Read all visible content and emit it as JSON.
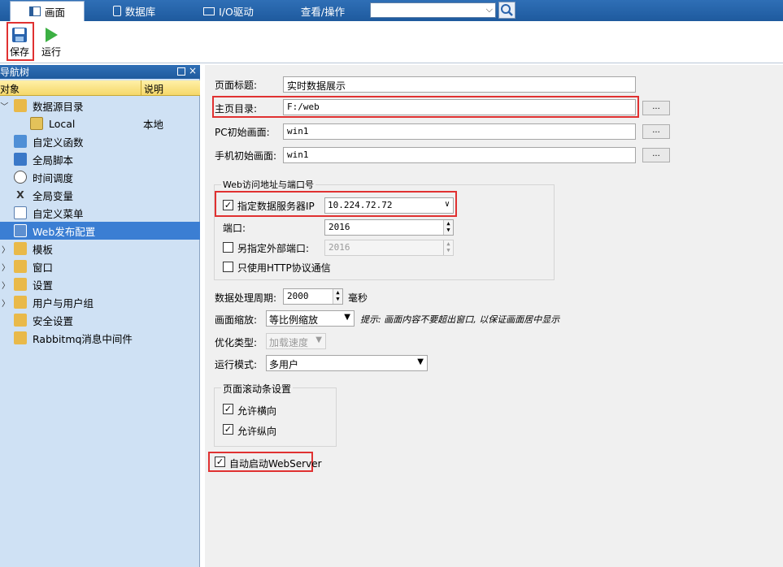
{
  "top_tabs": [
    {
      "label": "画面",
      "icon": "screen-icon"
    },
    {
      "label": "数据库",
      "icon": "database-icon"
    },
    {
      "label": "I/O驱动",
      "icon": "io-driver-icon"
    },
    {
      "label": "查看/操作",
      "icon": ""
    }
  ],
  "search": {
    "value": ""
  },
  "toolbar": {
    "save_label": "保存",
    "run_label": "运行"
  },
  "sidebar": {
    "title": "导航树",
    "col_object": "对象",
    "col_desc": "说明",
    "items": [
      {
        "label": "数据源目录",
        "desc": "",
        "expanded": true
      },
      {
        "label": "Local",
        "desc": "本地"
      },
      {
        "label": "自定义函数",
        "desc": ""
      },
      {
        "label": "全局脚本",
        "desc": ""
      },
      {
        "label": "时间调度",
        "desc": ""
      },
      {
        "label": "全局变量",
        "desc": ""
      },
      {
        "label": "自定义菜单",
        "desc": ""
      },
      {
        "label": "Web发布配置",
        "desc": "",
        "selected": true
      },
      {
        "label": "模板",
        "desc": ""
      },
      {
        "label": "窗口",
        "desc": ""
      },
      {
        "label": "设置",
        "desc": ""
      },
      {
        "label": "用户与用户组",
        "desc": ""
      },
      {
        "label": "安全设置",
        "desc": ""
      },
      {
        "label": "Rabbitmq消息中间件",
        "desc": ""
      }
    ]
  },
  "form": {
    "page_title_label": "页面标题:",
    "page_title_value": "实时数据展示",
    "home_dir_label": "主页目录:",
    "home_dir_value": "F:/web",
    "pc_init_label": "PC初始画面:",
    "pc_init_value": "win1",
    "mobile_init_label": "手机初始画面:",
    "mobile_init_value": "win1",
    "browse_label": "...",
    "web_group_title": "Web访问地址与端口号",
    "server_ip_label": "指定数据服务器IP",
    "server_ip_checked": true,
    "server_ip_value": "10.224.72.72",
    "port_label": "端口:",
    "port_value": "2016",
    "ext_port_label": "另指定外部端口:",
    "ext_port_checked": false,
    "ext_port_value": "2016",
    "http_only_label": "只使用HTTP协议通信",
    "http_only_checked": false,
    "period_label": "数据处理周期:",
    "period_value": "2000",
    "period_unit": "毫秒",
    "scale_label": "画面缩放:",
    "scale_value": "等比例缩放",
    "scale_hint": "提示: 画面内容不要超出窗口, 以保证画面居中显示",
    "opt_label": "优化类型:",
    "opt_value": "加载速度",
    "mode_label": "运行模式:",
    "mode_value": "多用户",
    "scroll_group_title": "页面滚动条设置",
    "allow_h_label": "允许横向",
    "allow_h_checked": true,
    "allow_v_label": "允许纵向",
    "allow_v_checked": true,
    "auto_start_label": "自动启动WebServer",
    "auto_start_checked": true
  },
  "colors": {
    "accent": "#2a64ad",
    "selection": "#3b7ed3",
    "highlight": "#e03131"
  }
}
